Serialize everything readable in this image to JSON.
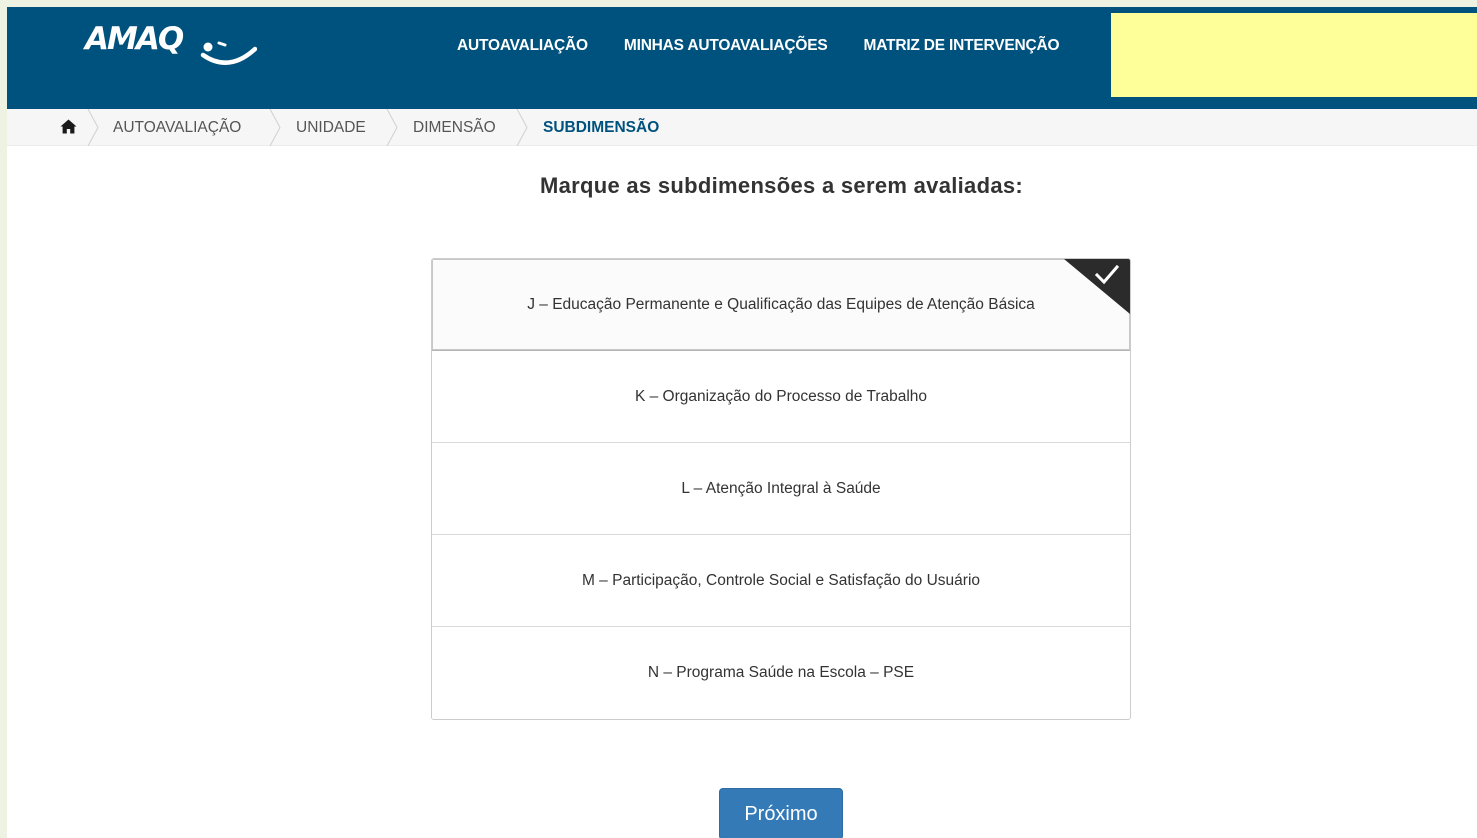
{
  "header": {
    "logo_text": "AMAQ",
    "nav": [
      {
        "label": "AUTOAVALIAÇÃO"
      },
      {
        "label": "MINHAS AUTOAVALIAÇÕES"
      },
      {
        "label": "MATRIZ DE INTERVENÇÃO"
      }
    ]
  },
  "breadcrumb": {
    "home_icon": "home-icon",
    "items": [
      {
        "label": "AUTOAVALIAÇÃO"
      },
      {
        "label": "UNIDADE"
      },
      {
        "label": "DIMENSÃO"
      },
      {
        "label": "SUBDIMENSÃO",
        "active": true
      }
    ]
  },
  "main": {
    "heading": "Marque as subdimensões a serem avaliadas:",
    "options": [
      {
        "label": "J – Educação Permanente e Qualificação das Equipes de Atenção Básica",
        "selected": true
      },
      {
        "label": "K – Organização do Processo de Trabalho",
        "selected": false
      },
      {
        "label": "L – Atenção Integral à Saúde",
        "selected": false
      },
      {
        "label": "M – Participação, Controle Social e Satisfação do Usuário",
        "selected": false
      },
      {
        "label": "N – Programa Saúde na Escola – PSE",
        "selected": false
      }
    ],
    "next_label": "Próximo"
  },
  "colors": {
    "header_bg": "#00527e",
    "highlight": "#ffff99",
    "button": "#337ab7",
    "active_crumb": "#00527e"
  }
}
